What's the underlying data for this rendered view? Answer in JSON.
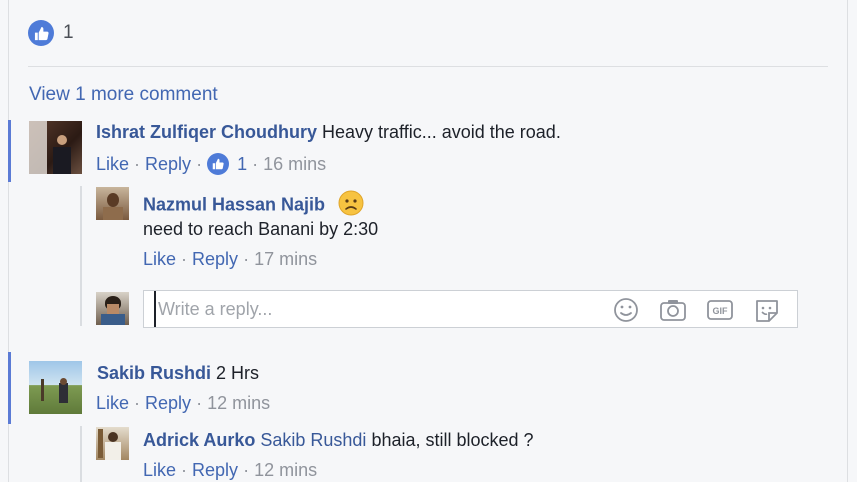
{
  "reactions": {
    "icon": "like-icon",
    "count": "1"
  },
  "view_more": "View 1 more comment",
  "comments": [
    {
      "author": "Ishrat Zulfiqer Choudhury",
      "text": "Heavy traffic... avoid the road.",
      "like": "Like",
      "reply": "Reply",
      "like_count": "1",
      "time": "16 mins",
      "replies": [
        {
          "author": "Nazmul Hassan Najib",
          "emoji": "frowning-emoji",
          "text": "need to reach Banani by 2:30",
          "like": "Like",
          "reply": "Reply",
          "time": "17 mins"
        }
      ],
      "reply_box": {
        "placeholder": "Write a reply...",
        "icons": [
          "emoji-icon",
          "camera-icon",
          "gif-icon",
          "sticker-icon"
        ]
      }
    },
    {
      "author": "Sakib Rushdi",
      "text": "2 Hrs",
      "like": "Like",
      "reply": "Reply",
      "time": "12 mins",
      "replies": [
        {
          "author": "Adrick Aurko",
          "mention": "Sakib Rushdi",
          "text": "bhaia, still blocked ?",
          "like": "Like",
          "reply": "Reply",
          "time": "12 mins"
        }
      ]
    }
  ],
  "colors": {
    "link": "#4267b2",
    "author": "#385898",
    "meta": "#90949c",
    "accent_bar": "#5b7bd5"
  }
}
